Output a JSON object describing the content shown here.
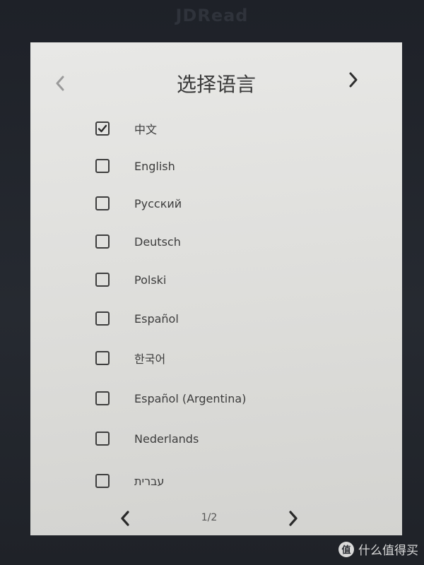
{
  "device": {
    "brand": "JDRead"
  },
  "header": {
    "title": "选择语言"
  },
  "languages": [
    {
      "label": "中文",
      "checked": true
    },
    {
      "label": "English",
      "checked": false
    },
    {
      "label": "Русский",
      "checked": false
    },
    {
      "label": "Deutsch",
      "checked": false
    },
    {
      "label": "Polski",
      "checked": false
    },
    {
      "label": "Español",
      "checked": false
    },
    {
      "label": "한국어",
      "checked": false
    },
    {
      "label": "Español (Argentina)",
      "checked": false
    },
    {
      "label": "Nederlands",
      "checked": false
    },
    {
      "label": "עברית",
      "checked": false
    }
  ],
  "pagination": {
    "indicator": "1/2",
    "current_page": 1,
    "total_pages": 2
  },
  "icons": {
    "header_prev": "chevron-left-icon",
    "header_next": "chevron-right-icon",
    "checkbox_checked": "check-icon",
    "footer_prev": "chevron-left-icon",
    "footer_next": "chevron-right-icon"
  },
  "watermark": {
    "text": "什么值得买",
    "logo": "值"
  },
  "colors": {
    "screen": "#dededb",
    "bezel": "#22252c",
    "text": "#3c3c3c",
    "disabled_chevron": "#9a9a9a"
  }
}
